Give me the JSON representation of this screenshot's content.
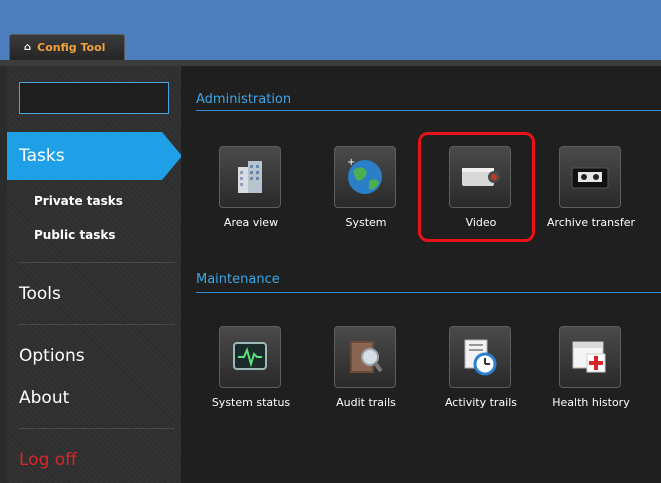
{
  "app": {
    "tab_label": "Config Tool"
  },
  "sidebar": {
    "search_value": "",
    "tasks_label": "Tasks",
    "sub_items": [
      "Private tasks",
      "Public tasks"
    ],
    "tools_label": "Tools",
    "options_label": "Options",
    "about_label": "About",
    "logoff_label": "Log off"
  },
  "sections": [
    {
      "title": "Administration",
      "tiles": [
        {
          "label": "Area view",
          "icon": "building-icon"
        },
        {
          "label": "System",
          "icon": "globe-icon"
        },
        {
          "label": "Video",
          "icon": "camera-icon"
        },
        {
          "label": "Archive transfer",
          "icon": "tape-icon"
        }
      ]
    },
    {
      "title": "Maintenance",
      "tiles": [
        {
          "label": "System status",
          "icon": "monitor-icon"
        },
        {
          "label": "Audit trails",
          "icon": "book-search-icon"
        },
        {
          "label": "Activity trails",
          "icon": "clock-doc-icon"
        },
        {
          "label": "Health history",
          "icon": "medical-calendar-icon"
        }
      ]
    }
  ],
  "colors": {
    "accent": "#1fa0e6",
    "highlight": "#e8121b",
    "section_title": "#3ea6e8",
    "logoff": "#d8252a",
    "tab_text": "#f2a23a"
  }
}
